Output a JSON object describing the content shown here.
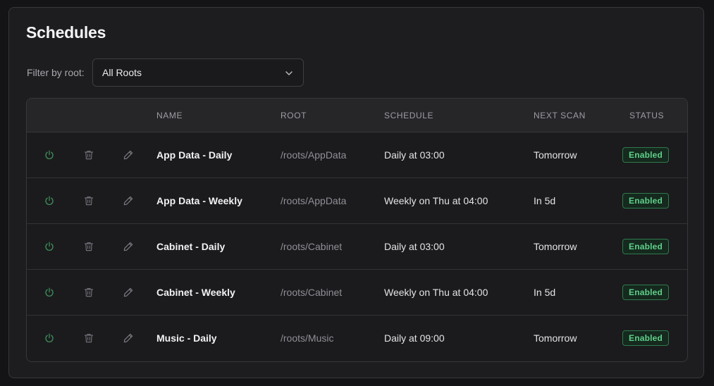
{
  "page": {
    "title": "Schedules",
    "filter_label": "Filter by root:",
    "filter_value": "All Roots"
  },
  "table": {
    "headers": {
      "name": "NAME",
      "root": "ROOT",
      "schedule": "SCHEDULE",
      "next_scan": "NEXT SCAN",
      "status": "STATUS"
    },
    "rows": [
      {
        "name": "App Data - Daily",
        "root": "/roots/AppData",
        "schedule": "Daily at 03:00",
        "next_scan": "Tomorrow",
        "status": "Enabled"
      },
      {
        "name": "App Data - Weekly",
        "root": "/roots/AppData",
        "schedule": "Weekly on Thu at 04:00",
        "next_scan": "In 5d",
        "status": "Enabled"
      },
      {
        "name": "Cabinet - Daily",
        "root": "/roots/Cabinet",
        "schedule": "Daily at 03:00",
        "next_scan": "Tomorrow",
        "status": "Enabled"
      },
      {
        "name": "Cabinet - Weekly",
        "root": "/roots/Cabinet",
        "schedule": "Weekly on Thu at 04:00",
        "next_scan": "In 5d",
        "status": "Enabled"
      },
      {
        "name": "Music - Daily",
        "root": "/roots/Music",
        "schedule": "Daily at 09:00",
        "next_scan": "Tomorrow",
        "status": "Enabled"
      }
    ]
  },
  "icons": {
    "toggle": "power-icon",
    "delete": "trash-icon",
    "edit": "pencil-icon",
    "dropdown": "chevron-down-icon"
  },
  "colors": {
    "power_icon": "#3f8f5a",
    "status_enabled_text": "#5fd08a",
    "status_enabled_border": "#2f7a4d"
  }
}
